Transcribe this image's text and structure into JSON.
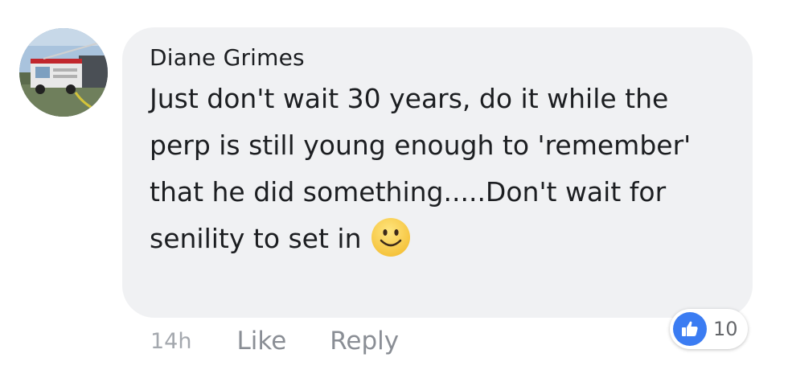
{
  "comment": {
    "author": "Diane Grimes",
    "text": "Just don't wait 30 years, do it while the perp is still young enough to 'remember' that he did something.....Don't wait for senility to set in",
    "emoji_icon": "smiley-face-icon",
    "timestamp": "14h",
    "like_label": "Like",
    "reply_label": "Reply",
    "reaction_count": "10",
    "reaction_icon": "thumbs-up-icon"
  },
  "colors": {
    "bubble": "#f0f1f3",
    "like_badge": "#3b7cf2",
    "text": "#1c1e21",
    "muted": "#8a8e95"
  }
}
